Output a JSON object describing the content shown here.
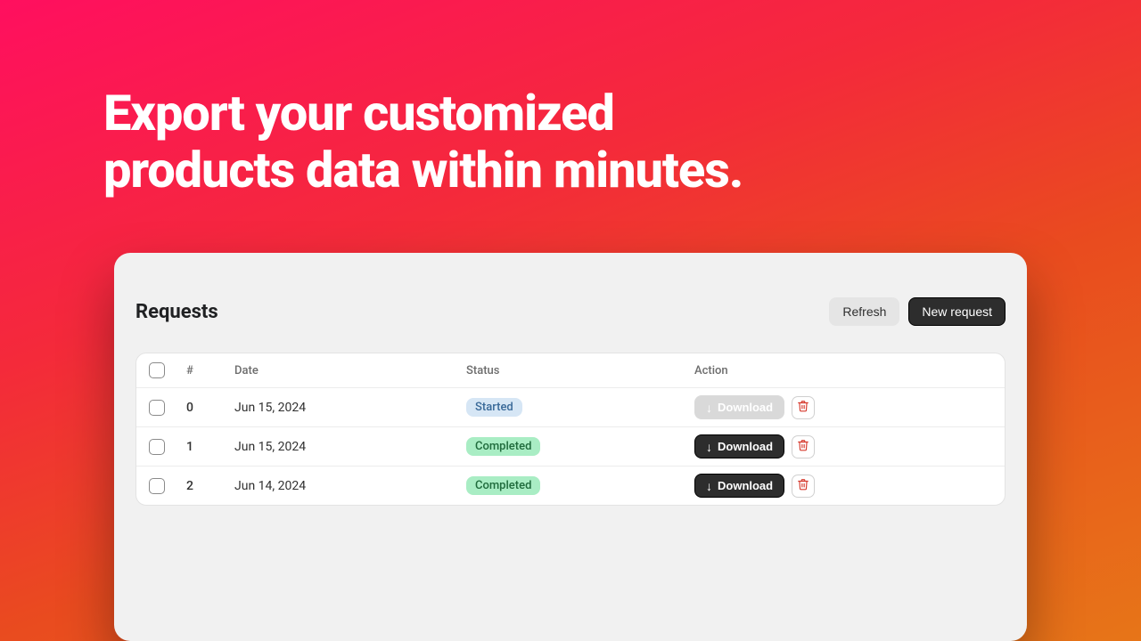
{
  "headline": {
    "line1": "Export your customized",
    "line2": "products data within minutes."
  },
  "panel": {
    "title": "Requests",
    "refresh_label": "Refresh",
    "new_request_label": "New request"
  },
  "table": {
    "headers": {
      "index": "#",
      "date": "Date",
      "status": "Status",
      "action": "Action"
    },
    "download_label": "Download",
    "rows": [
      {
        "index": "0",
        "date": "Jun 15, 2024",
        "status": "Started",
        "status_kind": "started",
        "download_enabled": false
      },
      {
        "index": "1",
        "date": "Jun 15, 2024",
        "status": "Completed",
        "status_kind": "completed",
        "download_enabled": true
      },
      {
        "index": "2",
        "date": "Jun 14, 2024",
        "status": "Completed",
        "status_kind": "completed",
        "download_enabled": true
      }
    ]
  }
}
